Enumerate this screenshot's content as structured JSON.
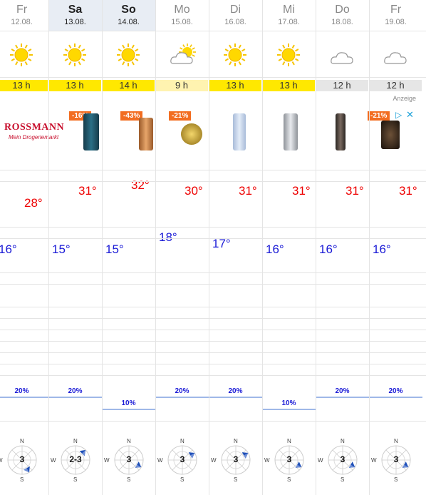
{
  "days": [
    {
      "day": "Fr",
      "date": "12.08.",
      "weather": "sun",
      "hours": "13 h",
      "hours_type": "yellow",
      "high": "28°",
      "low": "16°",
      "rain": "20%",
      "wind": "3"
    },
    {
      "day": "Sa",
      "date": "13.08.",
      "weather": "sun",
      "hours": "13 h",
      "hours_type": "yellow",
      "high": "31°",
      "low": "15°",
      "rain": "20%",
      "wind": "2-3"
    },
    {
      "day": "So",
      "date": "14.08.",
      "weather": "sun",
      "hours": "14 h",
      "hours_type": "yellow",
      "high": "32°",
      "low": "15°",
      "rain": "10%",
      "wind": "3"
    },
    {
      "day": "Mo",
      "date": "15.08.",
      "weather": "partly-cloudy",
      "hours": "9 h",
      "hours_type": "light",
      "high": "30°",
      "low": "18°",
      "rain": "20%",
      "wind": "3"
    },
    {
      "day": "Di",
      "date": "16.08.",
      "weather": "sun",
      "hours": "13 h",
      "hours_type": "yellow",
      "high": "31°",
      "low": "17°",
      "rain": "20%",
      "wind": "3"
    },
    {
      "day": "Mi",
      "date": "17.08.",
      "weather": "sun",
      "hours": "13 h",
      "hours_type": "yellow",
      "high": "31°",
      "low": "16°",
      "rain": "10%",
      "wind": "3"
    },
    {
      "day": "Do",
      "date": "18.08.",
      "weather": "cloud",
      "hours": "12 h",
      "hours_type": "gray",
      "high": "31°",
      "low": "16°",
      "rain": "20%",
      "wind": "3"
    },
    {
      "day": "Fr",
      "date": "19.08.",
      "weather": "cloud",
      "hours": "12 h",
      "hours_type": "gray",
      "high": "31°",
      "low": "16°",
      "rain": "20%",
      "wind": "3"
    }
  ],
  "ad": {
    "label": "Anzeige",
    "brand": "ROSSMANN",
    "tagline": "Mein Drogeriemarkt",
    "badges": [
      "-16%",
      "-43%",
      "-21%",
      "-21%"
    ],
    "close": "✕",
    "info": "▷"
  },
  "compass": {
    "n": "N",
    "s": "S",
    "w": "W"
  },
  "colors": {
    "high": "#e00000",
    "low": "#1a1ad6",
    "sun_yellow": "#ffe800",
    "accent_blue": "#1e4fb8"
  }
}
